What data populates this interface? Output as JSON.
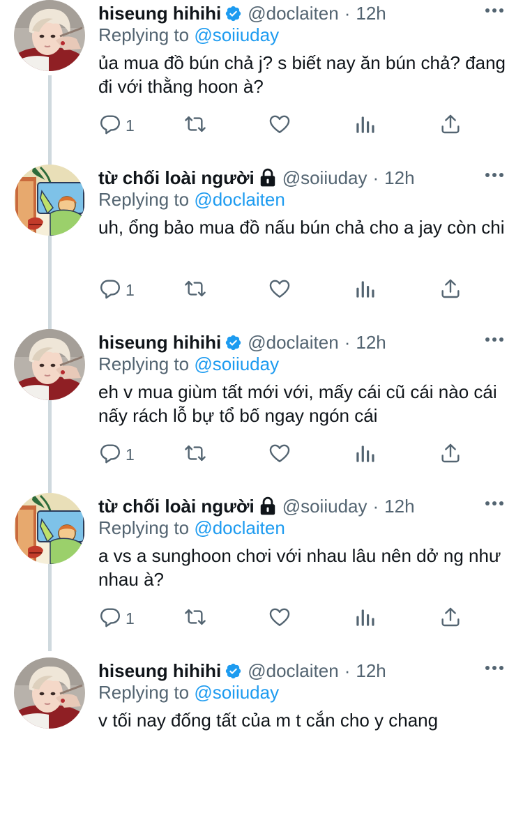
{
  "replying_prefix": "Replying to",
  "tweets": [
    {
      "name": "hiseung hihihi",
      "handle": "@doclaiten",
      "separator": "·",
      "time": "12h",
      "verified": true,
      "protected": false,
      "replying_to": "@soiiuday",
      "text": "ủa mua đồ bún chả j? s biết nay ăn bún chả? đang đi với thằng hoon à?",
      "reply_count": "1",
      "avatar": "photo-avatar"
    },
    {
      "name": "từ chối loài người",
      "handle": "@soiiuday",
      "separator": "·",
      "time": "12h",
      "verified": false,
      "protected": true,
      "replying_to": "@doclaiten",
      "text": "uh, ổng bảo mua đồ nấu bún chả cho a jay còn chi",
      "reply_count": "1",
      "avatar": "cartoon-avatar"
    },
    {
      "name": "hiseung hihihi",
      "handle": "@doclaiten",
      "separator": "·",
      "time": "12h",
      "verified": true,
      "protected": false,
      "replying_to": "@soiiuday",
      "text": "eh v mua giùm tất mới với, mấy cái cũ cái nào cái nấy rách lỗ bự tổ bố ngay ngón cái",
      "reply_count": "1",
      "avatar": "photo-avatar"
    },
    {
      "name": "từ chối loài người",
      "handle": "@soiiuday",
      "separator": "·",
      "time": "12h",
      "verified": false,
      "protected": true,
      "replying_to": "@doclaiten",
      "text": "a vs a sunghoon chơi với nhau lâu nên dở ng như nhau à?",
      "reply_count": "1",
      "avatar": "cartoon-avatar"
    },
    {
      "name": "hiseung hihihi",
      "handle": "@doclaiten",
      "separator": "·",
      "time": "12h",
      "verified": true,
      "protected": false,
      "replying_to": "@soiiuday",
      "text": "v tối nay đống tất của m t cắn cho y chang",
      "reply_count": "",
      "avatar": "photo-avatar"
    }
  ],
  "icons": {
    "reply": "reply-icon",
    "retweet": "retweet-icon",
    "like": "heart-icon",
    "analytics": "analytics-icon",
    "share": "share-icon",
    "more": "more-icon",
    "verified": "verified-badge-icon",
    "protected": "lock-icon"
  },
  "colors": {
    "link": "#1d9bf0",
    "secondary_text": "#536471",
    "primary_text": "#0f1419",
    "verified": "#1d9bf0",
    "thread_line": "#cfd9de"
  }
}
